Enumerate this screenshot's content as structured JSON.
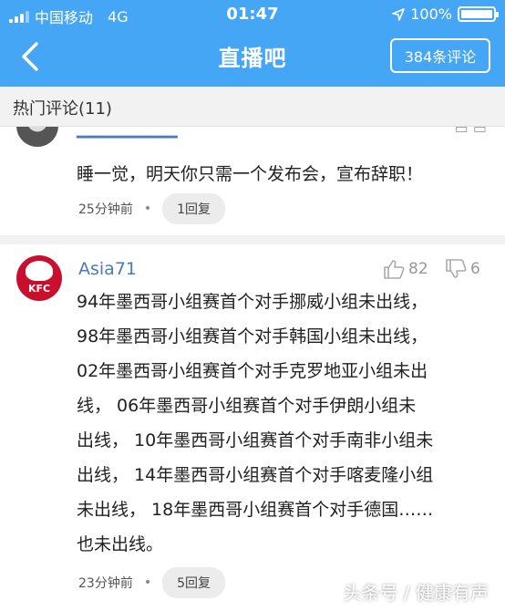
{
  "status_bar": {
    "carrier": "中国移动",
    "network": "4G",
    "time": "01:47",
    "battery": "100%"
  },
  "header": {
    "title": "直播吧",
    "comments_button": "384条评论"
  },
  "section": {
    "title": "热门评论(11)"
  },
  "comments": [
    {
      "text": "睡一觉，明天你只需一个发布会，宣布辞职！",
      "time": "25分钟前",
      "replies": "1回复"
    },
    {
      "user": "Asia71",
      "likes": "82",
      "dislikes": "6",
      "lines": [
        "94年墨西哥小组赛首个对手挪威小组未出线，",
        "98年墨西哥小组赛首个对手韩国小组未出线，",
        "02年墨西哥小组赛首个对手克罗地亚小组未出",
        "线， 06年墨西哥小组赛首个对手伊朗小组未",
        "出线， 10年墨西哥小组赛首个对手南非小组未",
        "出线， 14年墨西哥小组赛首个对手喀麦隆小组",
        "未出线， 18年墨西哥小组赛首个对手德国……",
        "也未出线。"
      ],
      "time": "23分钟前",
      "replies": "5回复"
    }
  ],
  "watermark": "头条号 / 健康有声",
  "colors": {
    "header_bg": "#46a6f6",
    "username": "#4a7ab8"
  }
}
